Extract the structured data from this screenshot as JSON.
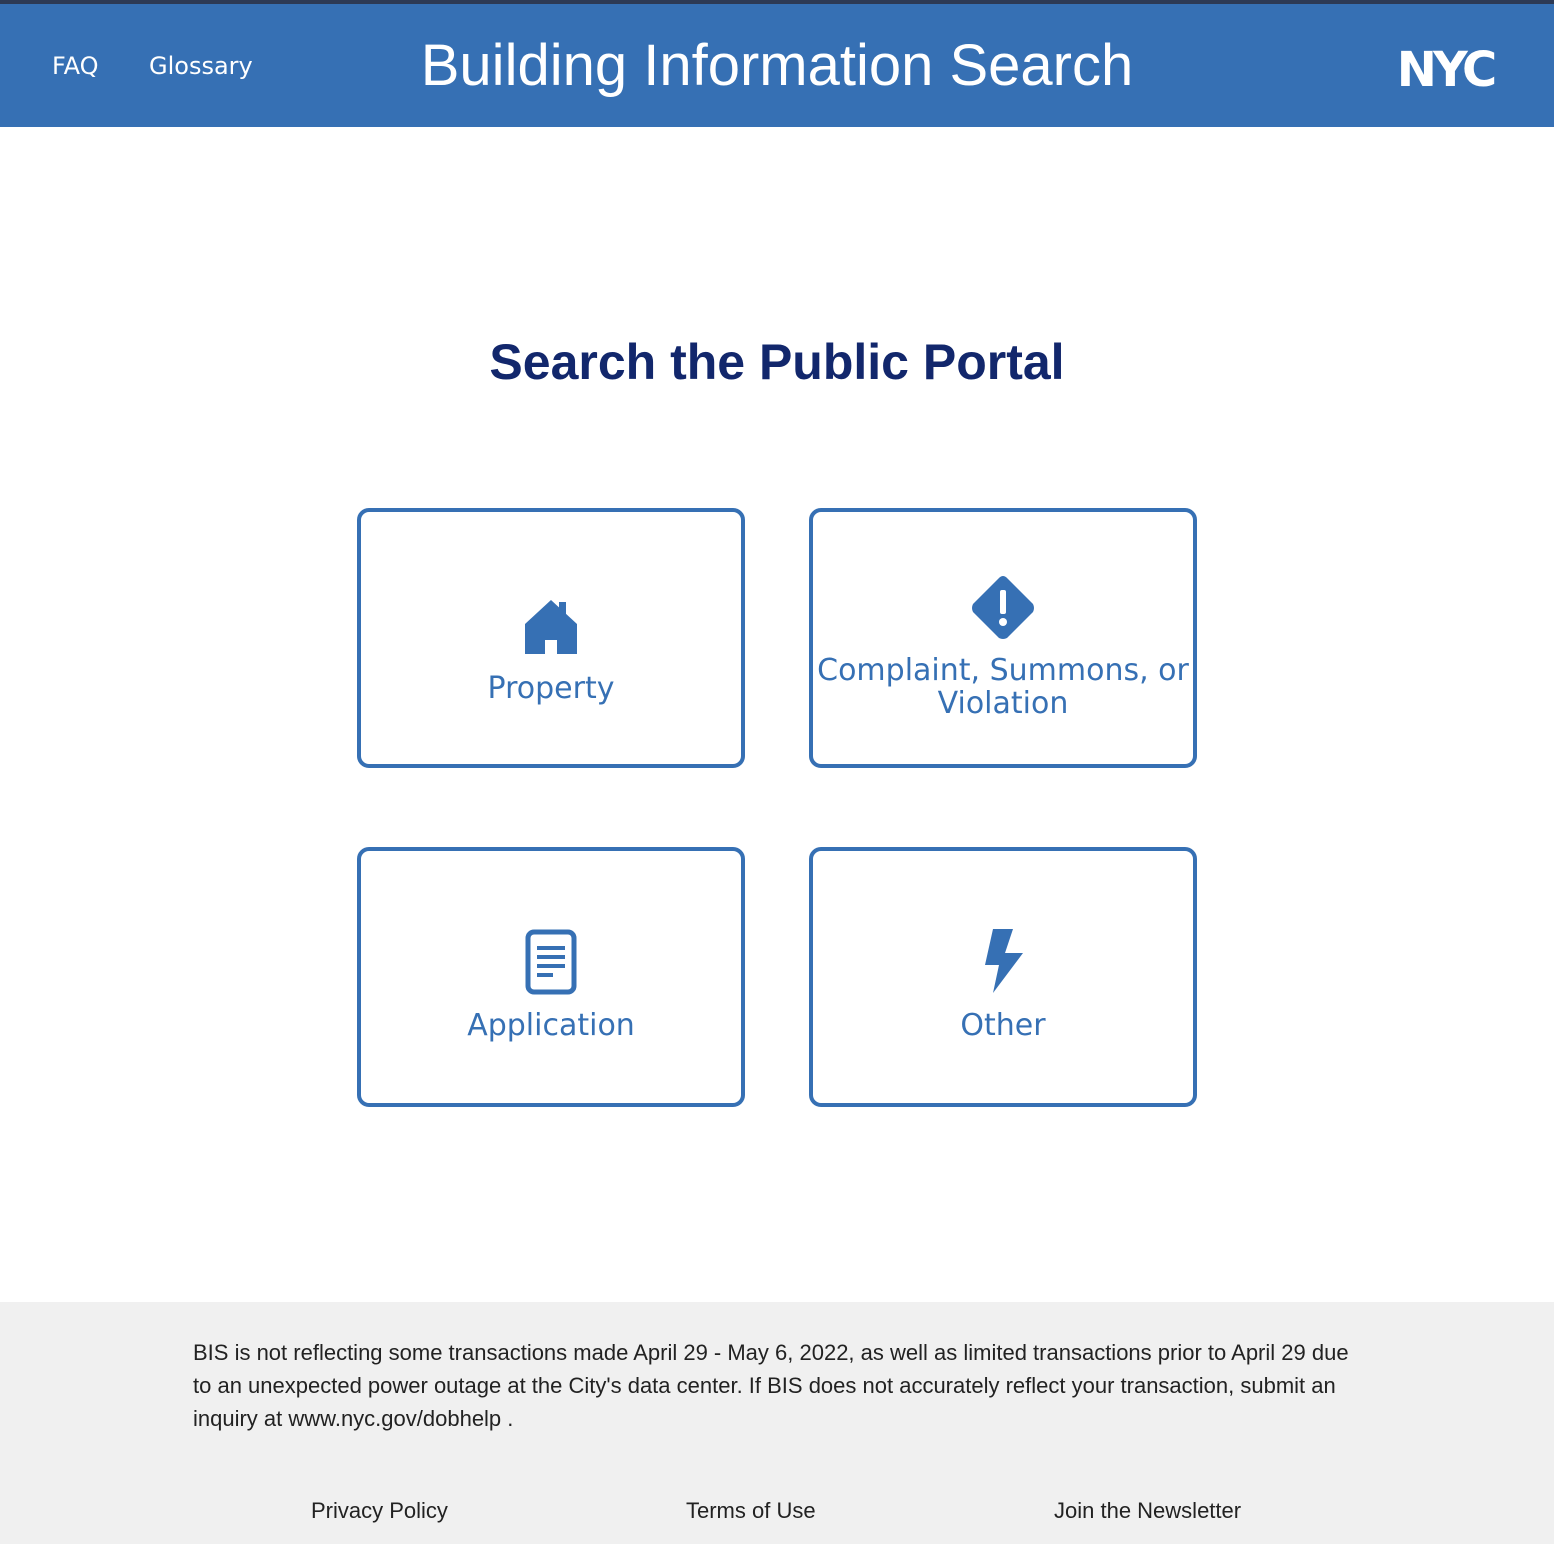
{
  "header": {
    "nav": [
      {
        "label": "FAQ",
        "icon": null
      },
      {
        "label": "Glossary",
        "icon": null
      }
    ],
    "title": "Building Information Search",
    "logo": {
      "icon": "nyc-logo",
      "text": "NYC"
    }
  },
  "main": {
    "heading": "Search the Public Portal",
    "cards": [
      {
        "label": "Property",
        "icon": "house-icon"
      },
      {
        "label_line1": "Complaint, Summons, or",
        "label_line2": "Violation",
        "icon": "warning-diamond-icon"
      },
      {
        "label": "Application",
        "icon": "document-icon"
      },
      {
        "label": "Other",
        "icon": "lightning-bolt-icon"
      }
    ]
  },
  "footer": {
    "notice": "BIS is not reflecting some transactions made April 29 - May 6, 2022, as well as limited transactions prior to April 29 due to an unexpected power outage at the City's data center. If BIS does not accurately reflect your transaction, submit an inquiry at www.nyc.gov/dobhelp .",
    "links": [
      {
        "label": "Privacy Policy"
      },
      {
        "label": "Terms of Use"
      },
      {
        "label": "Join the Newsletter"
      }
    ]
  },
  "colors": {
    "header_bg": "#3670b4",
    "heading_text": "#12276c",
    "card_accent": "#3670b4",
    "footer_bg": "#f0f0f0"
  }
}
